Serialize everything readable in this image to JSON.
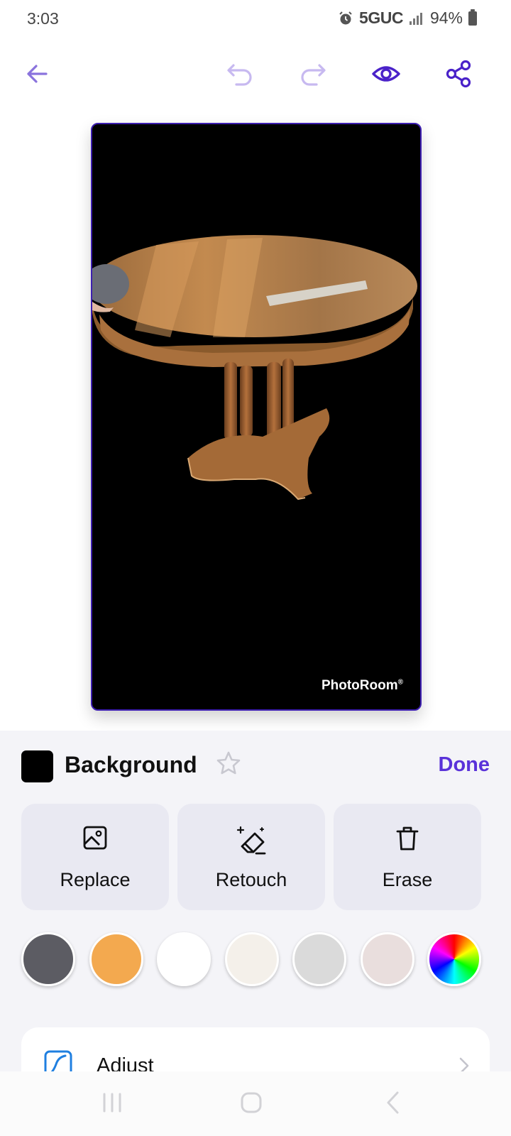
{
  "status": {
    "time": "3:03",
    "network": "5GUC",
    "battery": "94%"
  },
  "toolbar": {
    "back_icon": "arrow-left-icon",
    "undo_icon": "undo-icon",
    "redo_icon": "redo-icon",
    "preview_icon": "eye-icon",
    "share_icon": "share-icon"
  },
  "canvas": {
    "watermark": "PhotoRoom",
    "watermark_mark": "®"
  },
  "panel": {
    "title": "Background",
    "done_label": "Done",
    "actions": [
      {
        "label": "Replace",
        "icon": "image-icon"
      },
      {
        "label": "Retouch",
        "icon": "eraser-sparkle-icon"
      },
      {
        "label": "Erase",
        "icon": "trash-icon"
      }
    ],
    "colors": [
      "#5c5c63",
      "#f3a94f",
      "#ffffff",
      "#f4f0ea",
      "#dadada",
      "#e9dedd",
      "rainbow"
    ],
    "adjust_label": "Adjust"
  },
  "accent": "#5a32d9"
}
